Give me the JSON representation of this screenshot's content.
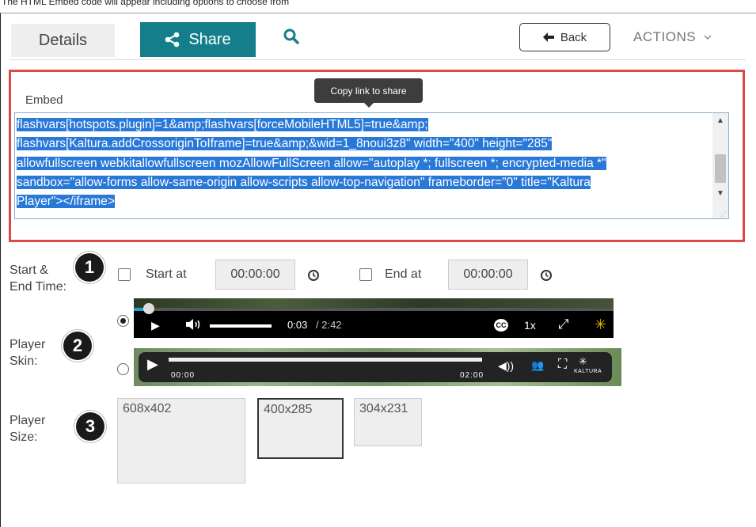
{
  "caption": "The HTML Embed code will appear including options to choose from",
  "tabs": {
    "details_label": "Details",
    "share_label": "Share"
  },
  "header": {
    "back_label": "Back",
    "actions_label": "ACTIONS"
  },
  "embed": {
    "label": "Embed",
    "tooltip": "Copy link to share",
    "lines": [
      "flashvars[hotspots.plugin]=1&amp;flashvars[forceMobileHTML5]=true&amp;",
      "flashvars[Kaltura.addCrossoriginToIframe]=true&amp;&wid=1_8noui3z8\" width=\"400\" height=\"285\"",
      "allowfullscreen webkitallowfullscreen mozAllowFullScreen allow=\"autoplay *; fullscreen *; encrypted-media *\"",
      "sandbox=\"allow-forms allow-same-origin allow-scripts allow-top-navigation\" frameborder=\"0\" title=\"Kaltura",
      "Player\"></iframe>"
    ]
  },
  "time": {
    "label_line1": "Start &",
    "label_line2": "End Time:",
    "step": "1",
    "start_label": "Start at",
    "start_value": "00:00:00",
    "end_label": "End at",
    "end_value": "00:00:00"
  },
  "skin": {
    "label_line1": "Player",
    "label_line2": "Skin:",
    "step": "2",
    "skin1_time": "0:03",
    "skin1_duration": "/ 2:42",
    "skin1_speed": "1x",
    "skin2_time": "00:00",
    "skin2_duration": "02:00",
    "skin2_brand": "KALTURA",
    "selected": "skin1"
  },
  "size": {
    "label_line1": "Player",
    "label_line2": "Size:",
    "step": "3",
    "options": [
      "608x402",
      "400x285",
      "304x231"
    ],
    "selected": "400x285"
  },
  "colors": {
    "share_tab": "#147f8a",
    "highlight_border": "#e04848",
    "selection": "#2878d8"
  }
}
